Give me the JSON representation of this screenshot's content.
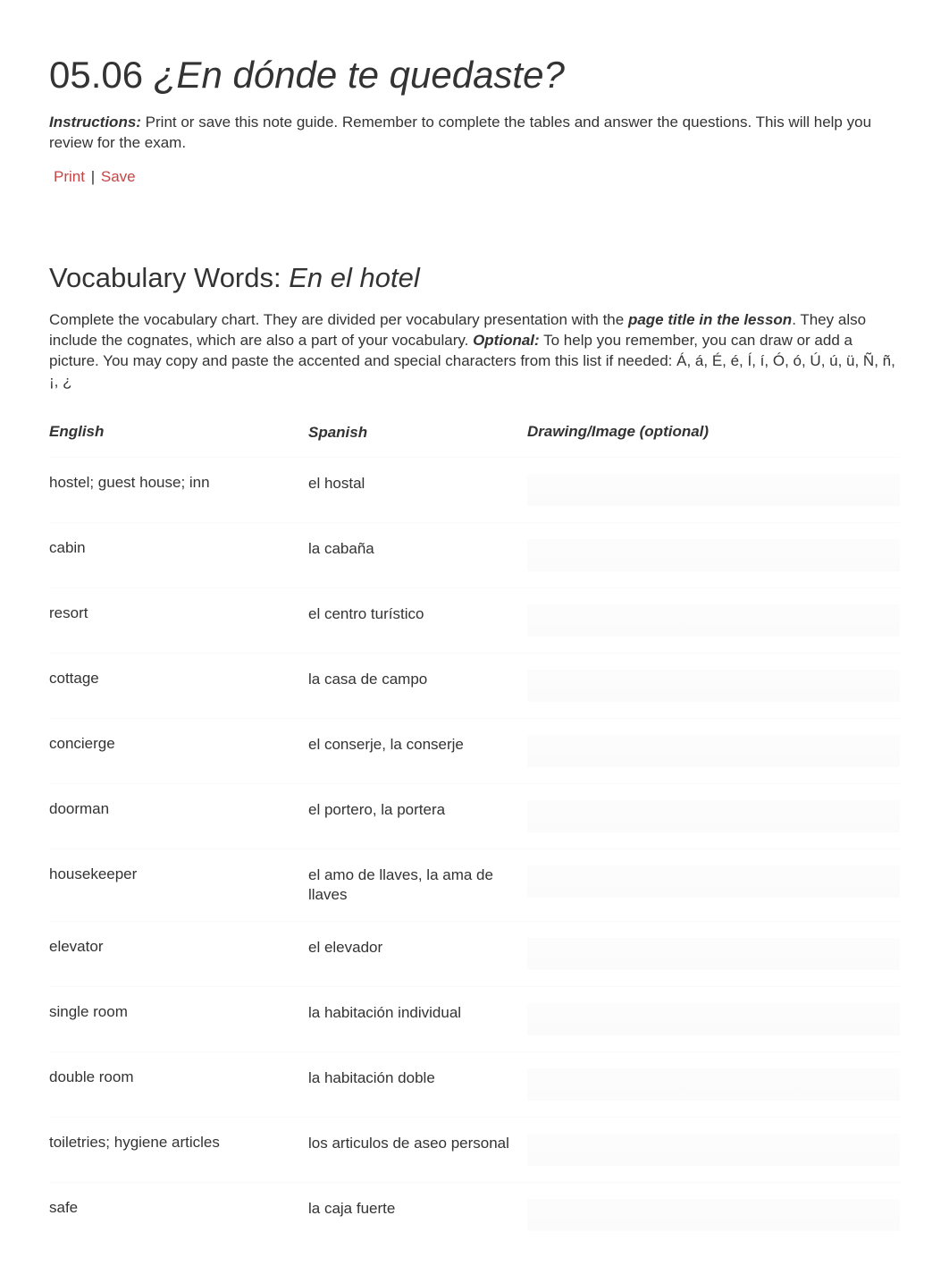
{
  "lesson": {
    "number": "05.06",
    "title_italic": "¿En dónde te quedaste?"
  },
  "instructions": {
    "label": "Instructions:",
    "text": " Print or save this note guide. Remember to complete the tables and answer the questions. This will help you review for the exam."
  },
  "actions": {
    "print": "Print",
    "save": "Save"
  },
  "section": {
    "heading_prefix": "Vocabulary Words: ",
    "heading_italic": "En el hotel",
    "desc_part1": "Complete the vocabulary chart. They are divided per vocabulary presentation with the ",
    "desc_bold1": "page title in the lesson",
    "desc_part2": ". They also include the cognates, which are also a part of your vocabulary. ",
    "desc_bold2": "Optional:",
    "desc_part3": " To help you remember, you can draw or add a picture. You may copy and paste the accented and special characters from this list if needed: Á, á, É, é, Í, í, Ó, ó, Ú, ú, ü, Ñ, ñ, ¡, ¿"
  },
  "table": {
    "headers": {
      "english": "English",
      "spanish": "Spanish",
      "image": "Drawing/Image (optional)"
    },
    "rows": [
      {
        "english": "hostel; guest house; inn",
        "spanish": "el hostal"
      },
      {
        "english": "cabin",
        "spanish": "la cabaña"
      },
      {
        "english": "resort",
        "spanish": "el centro turístico"
      },
      {
        "english": "cottage",
        "spanish": "la casa de campo"
      },
      {
        "english": "concierge",
        "spanish": "el conserje, la conserje"
      },
      {
        "english": "doorman",
        "spanish": "el portero, la portera"
      },
      {
        "english": "housekeeper",
        "spanish": "el amo de llaves, la ama de llaves"
      },
      {
        "english": "elevator",
        "spanish": "el elevador"
      },
      {
        "english": "single room",
        "spanish": "la habitación individual"
      },
      {
        "english": "double room",
        "spanish": "la habitación doble"
      },
      {
        "english": "toiletries; hygiene articles",
        "spanish": "los articulos de aseo personal"
      },
      {
        "english": "safe",
        "spanish": "la caja fuerte"
      }
    ]
  }
}
